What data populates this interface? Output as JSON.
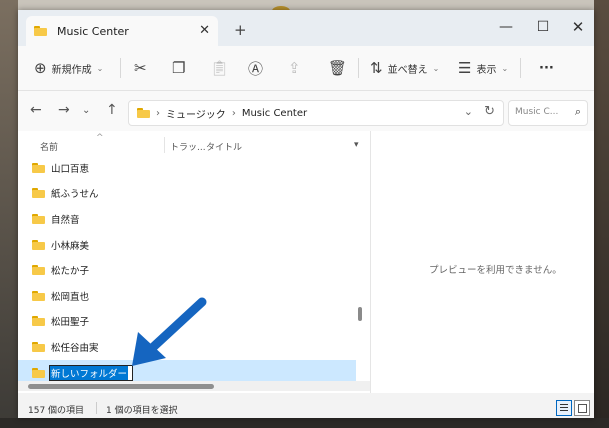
{
  "window": {
    "tab_title": "Music Center",
    "close_tab": "✕",
    "new_tab": "+",
    "minimize": "—",
    "maximize": "☐",
    "close": "✕"
  },
  "toolbar": {
    "new_label": "新規作成",
    "sort_label": "並べ替え",
    "view_label": "表示",
    "more_label": "···"
  },
  "address": {
    "crumbs": [
      "ミュージック",
      "Music Center"
    ],
    "search_placeholder": "Music C..."
  },
  "columns": {
    "name": "名前",
    "track": "トラッ...",
    "title": "タイトル"
  },
  "files": [
    {
      "name": "山口百恵"
    },
    {
      "name": "紙ふうせん"
    },
    {
      "name": "自然音"
    },
    {
      "name": "小林麻美"
    },
    {
      "name": "松たか子"
    },
    {
      "name": "松岡直也"
    },
    {
      "name": "松田聖子"
    },
    {
      "name": "松任谷由実"
    }
  ],
  "rename": {
    "value": "新しいフォルダー"
  },
  "preview": {
    "message": "プレビューを利用できません。"
  },
  "status": {
    "item_count": "157 個の項目",
    "selected": "1 個の項目を選択"
  },
  "colors": {
    "accent": "#0078d4",
    "selection": "#cce8ff",
    "arrow": "#1565c0"
  }
}
